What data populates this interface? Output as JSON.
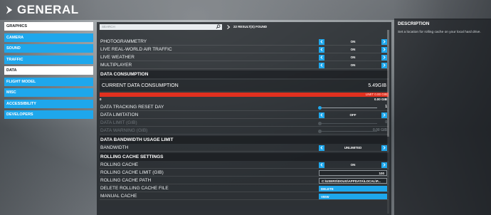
{
  "header": {
    "title": "GENERAL"
  },
  "menu": {
    "items": [
      {
        "label": "GRAPHICS",
        "active": true
      },
      {
        "label": "CAMERA",
        "active": false
      },
      {
        "label": "SOUND",
        "active": false
      },
      {
        "label": "TRAFFIC",
        "active": false
      },
      {
        "label": "DATA",
        "active": true
      },
      {
        "label": "FLIGHT MODEL",
        "active": false
      },
      {
        "label": "MISC",
        "active": false
      },
      {
        "label": "ACCESSIBILITY",
        "active": false
      },
      {
        "label": "DEVELOPERS",
        "active": false
      }
    ]
  },
  "search": {
    "placeholder": "SEARCH",
    "results": "22 RESULT(S) FOUND"
  },
  "settings": {
    "photogrammetry": {
      "label": "PHOTOGRAMMETRY",
      "value": "ON"
    },
    "live_air_traffic": {
      "label": "LIVE REAL-WORLD AIR TRAFFIC",
      "value": "ON"
    },
    "live_weather": {
      "label": "LIVE WEATHER",
      "value": "ON"
    },
    "multiplayer": {
      "label": "MULTIPLAYER",
      "value": "ON"
    },
    "data_consumption_section": "DATA CONSUMPTION",
    "current_consumption": {
      "label": "CURRENT DATA CONSUMPTION",
      "value": "5.49GIB"
    },
    "limit_text": "LIMIT 0.00 GIB",
    "bar_min": "0",
    "bar_max": "0.00 GIB",
    "reset_day": {
      "label": "DATA TRACKING RESET DAY",
      "value": "1"
    },
    "data_limitation": {
      "label": "DATA LIMITATION",
      "value": "OFF"
    },
    "data_limit": {
      "label": "DATA LIMIT (GIB)",
      "value": "0"
    },
    "data_warning": {
      "label": "DATA WARNING (GIB)",
      "value": "0.00 GIB"
    },
    "bandwidth_section": "DATA BANDWIDTH USAGE LIMIT",
    "bandwidth": {
      "label": "BANDWIDTH",
      "value": "UNLIMITED"
    },
    "rolling_section": "ROLLING CACHE SETTINGS",
    "rolling_cache": {
      "label": "ROLLING CACHE",
      "value": "ON"
    },
    "rolling_limit": {
      "label": "ROLLING CACHE LIMIT (GIB)",
      "value": "100"
    },
    "rolling_path": {
      "label": "ROLLING CACHE PATH",
      "value": "C:\\USERS\\DOUG\\APPDATA\\LOCAL\\P..."
    },
    "delete_cache": {
      "label": "DELETE ROLLING CACHE FILE",
      "button": "DELETE"
    },
    "manual_cache": {
      "label": "MANUAL CACHE",
      "button": "VIEW"
    }
  },
  "description": {
    "title": "DESCRIPTION",
    "text": "Set a location for rolling cache on your local hard drive."
  },
  "colors": {
    "accent": "#1ea7ec",
    "limit_bar": "#e1301f"
  }
}
